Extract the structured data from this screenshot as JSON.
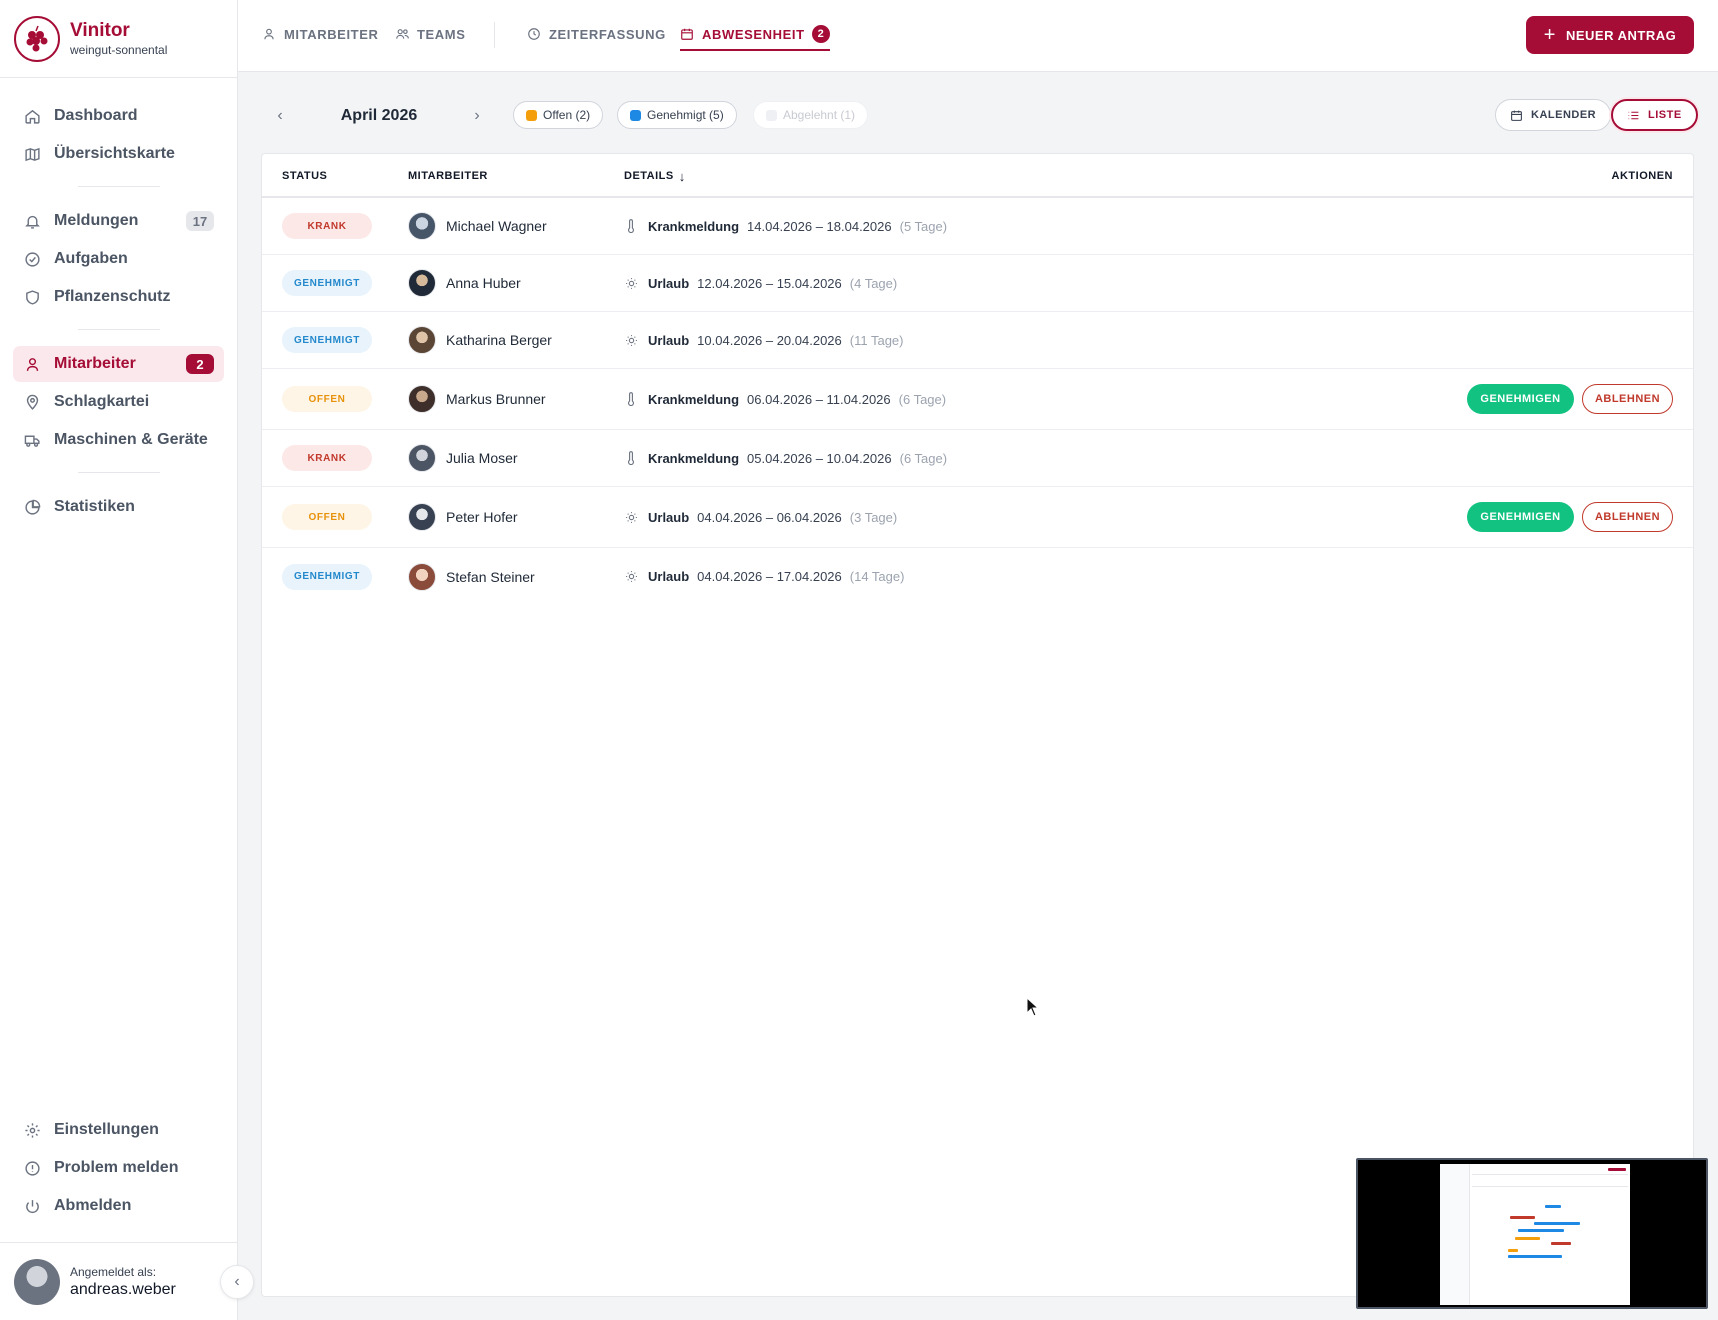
{
  "app": {
    "name": "Vinitor",
    "tenant": "weingut-sonnental"
  },
  "sidebar": {
    "items_top": [
      {
        "label": "Dashboard",
        "icon": "home-icon"
      },
      {
        "label": "Übersichtskarte",
        "icon": "map-icon"
      }
    ],
    "items_mid": [
      {
        "label": "Meldungen",
        "icon": "bell-icon",
        "badge": "17"
      },
      {
        "label": "Aufgaben",
        "icon": "check-circle-icon"
      },
      {
        "label": "Pflanzenschutz",
        "icon": "shield-icon"
      }
    ],
    "items_work": [
      {
        "label": "Mitarbeiter",
        "icon": "user-icon",
        "badge": "2",
        "active": true
      },
      {
        "label": "Schlagkartei",
        "icon": "map-pin-icon"
      },
      {
        "label": "Maschinen & Geräte",
        "icon": "truck-icon"
      }
    ],
    "items_stats": [
      {
        "label": "Statistiken",
        "icon": "pie-chart-icon"
      }
    ],
    "items_bottom": [
      {
        "label": "Einstellungen",
        "icon": "gear-icon"
      },
      {
        "label": "Problem melden",
        "icon": "alert-circle-icon"
      },
      {
        "label": "Abmelden",
        "icon": "power-icon"
      }
    ],
    "user": {
      "label": "Angemeldet als:",
      "name": "andreas.weber"
    }
  },
  "topnav": {
    "tabs": [
      {
        "label": "MITARBEITER",
        "icon": "user-icon"
      },
      {
        "label": "TEAMS",
        "icon": "users-icon"
      },
      {
        "label": "ZEITERFASSUNG",
        "icon": "clock-icon"
      },
      {
        "label": "ABWESENHEIT",
        "icon": "calendar-icon",
        "badge": "2",
        "active": true
      }
    ],
    "new_button": "NEUER ANTRAG"
  },
  "toolbar": {
    "month": "April 2026",
    "filters": [
      {
        "label": "Offen (2)",
        "color": "#f59e0b",
        "enabled": true
      },
      {
        "label": "Genehmigt (5)",
        "color": "#1e88e5",
        "enabled": true
      },
      {
        "label": "Abgelehnt (1)",
        "color": "#e5e7eb",
        "enabled": false
      }
    ],
    "views": [
      {
        "label": "KALENDER",
        "icon": "calendar-icon",
        "active": false
      },
      {
        "label": "LISTE",
        "icon": "list-icon",
        "active": true
      }
    ]
  },
  "table": {
    "headers": {
      "status": "STATUS",
      "employee": "MITARBEITER",
      "details": "DETAILS",
      "actions": "AKTIONEN"
    },
    "approve_label": "GENEHMIGEN",
    "reject_label": "ABLEHNEN",
    "rows": [
      {
        "status": "KRANK",
        "status_kind": "krank",
        "name": "Michael Wagner",
        "type": "Krankmeldung",
        "type_icon": "thermometer-icon",
        "range": "14.04.2026 – 18.04.2026",
        "days": "(5 Tage)",
        "actions": false
      },
      {
        "status": "GENEHMIGT",
        "status_kind": "genehmigt",
        "name": "Anna Huber",
        "type": "Urlaub",
        "type_icon": "sun-icon",
        "range": "12.04.2026 – 15.04.2026",
        "days": "(4 Tage)",
        "actions": false
      },
      {
        "status": "GENEHMIGT",
        "status_kind": "genehmigt",
        "name": "Katharina Berger",
        "type": "Urlaub",
        "type_icon": "sun-icon",
        "range": "10.04.2026 – 20.04.2026",
        "days": "(11 Tage)",
        "actions": false
      },
      {
        "status": "OFFEN",
        "status_kind": "offen",
        "name": "Markus Brunner",
        "type": "Krankmeldung",
        "type_icon": "thermometer-icon",
        "range": "06.04.2026 – 11.04.2026",
        "days": "(6 Tage)",
        "actions": true
      },
      {
        "status": "KRANK",
        "status_kind": "krank",
        "name": "Julia Moser",
        "type": "Krankmeldung",
        "type_icon": "thermometer-icon",
        "range": "05.04.2026 – 10.04.2026",
        "days": "(6 Tage)",
        "actions": false
      },
      {
        "status": "OFFEN",
        "status_kind": "offen",
        "name": "Peter Hofer",
        "type": "Urlaub",
        "type_icon": "sun-icon",
        "range": "04.04.2026 – 06.04.2026",
        "days": "(3 Tage)",
        "actions": true
      },
      {
        "status": "GENEHMIGT",
        "status_kind": "genehmigt",
        "name": "Stefan Steiner",
        "type": "Urlaub",
        "type_icon": "sun-icon",
        "range": "04.04.2026 – 17.04.2026",
        "days": "(14 Tage)",
        "actions": false
      }
    ]
  },
  "colors": {
    "brand": "#a50d36",
    "approve": "#11c281",
    "reject": "#c0392b"
  }
}
